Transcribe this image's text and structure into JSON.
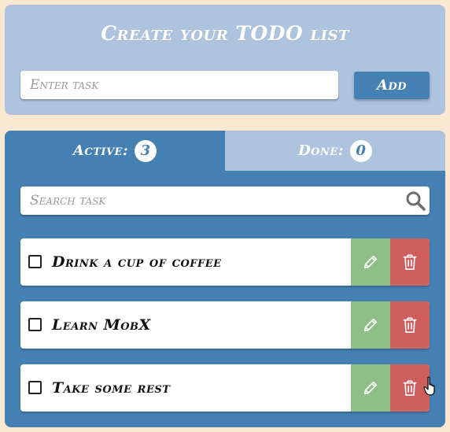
{
  "create": {
    "title": "Create your TODO list",
    "input_placeholder": "Enter task",
    "input_value": "",
    "add_label": "Add"
  },
  "tabs": {
    "active_label": "Active:",
    "active_count": "3",
    "done_label": "Done:",
    "done_count": "0"
  },
  "search": {
    "placeholder": "Search task",
    "value": ""
  },
  "todos": [
    {
      "text": "Drink a cup of coffee",
      "checked": false
    },
    {
      "text": "Learn MobX",
      "checked": false
    },
    {
      "text": "Take some rest",
      "checked": false
    }
  ],
  "icons": {
    "search": "search-icon",
    "edit": "pencil-icon",
    "delete": "trash-icon",
    "cursor": "hand-pointer-icon"
  },
  "colors": {
    "page_bg": "#fbe8d3",
    "card_light": "#aec3de",
    "card_dark": "#4580b3",
    "edit_green": "#8fbf87",
    "delete_red": "#cf5f5d"
  }
}
